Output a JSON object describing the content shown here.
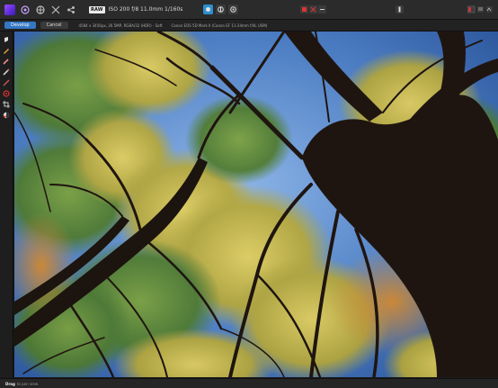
{
  "topbar": {
    "raw_badge": "RAW",
    "exif": "ISO 200 f/8 11.0mm 1/160s",
    "icons": [
      "app-logo",
      "photo-persona-icon",
      "develop-persona-icon",
      "liquify-persona-icon",
      "export-persona-icon"
    ]
  },
  "context": {
    "develop_label": "Develop",
    "cancel_label": "Cancel",
    "info": "4584 x 3456px, 26.5MP, RGBA/32 (HDR) - Soft",
    "camera": "Canon EOS 5D Mark II (Canon EF 11-24mm f/4L USM)"
  },
  "status": {
    "key": "Drag",
    "text": "to pan view."
  },
  "colors": {
    "accent": "#2d8fcf",
    "develop_button": "#3478c4",
    "sky": "#5f8fce"
  }
}
